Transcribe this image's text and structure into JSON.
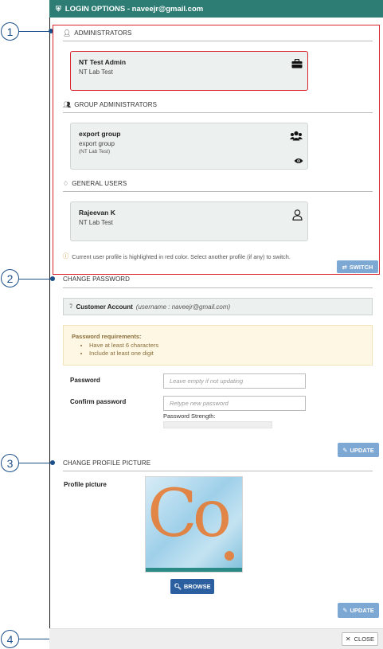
{
  "header": {
    "title": "LOGIN OPTIONS - naveejr@gmail.com"
  },
  "login_options": {
    "administrators": {
      "heading": "ADMINISTRATORS",
      "cards": [
        {
          "name": "NT Test Admin",
          "org": "NT Lab Test",
          "icon": "briefcase-icon",
          "active": true
        }
      ]
    },
    "group_administrators": {
      "heading": "GROUP ADMINISTRATORS",
      "cards": [
        {
          "name": "export group",
          "sub": "export group",
          "org": "(NT Lab Test)",
          "icon": "users-icon"
        }
      ]
    },
    "general_users": {
      "heading": "GENERAL USERS",
      "cards": [
        {
          "name": "Rajeevan K",
          "org": "NT Lab Test",
          "icon": "user-icon"
        }
      ]
    },
    "info": "Current user profile is highlighted in red color. Select another profile (if any) to switch.",
    "switch_label": "SWITCH"
  },
  "change_password": {
    "heading": "CHANGE PASSWORD",
    "account_label": "Customer Account",
    "account_detail": "(username : naveejr@gmail.com)",
    "requirements_title": "Password requirements:",
    "requirements": [
      "Have at least 6 characters",
      "Include at least one digit"
    ],
    "password_label": "Password",
    "password_placeholder": "Leave empty if not updating",
    "confirm_label": "Confirm password",
    "confirm_placeholder": "Retype new password",
    "strength_label": "Password Strength:",
    "update_label": "UPDATE"
  },
  "profile_picture": {
    "heading": "CHANGE PROFILE PICTURE",
    "label": "Profile picture",
    "browse_label": "BROWSE",
    "update_label": "UPDATE"
  },
  "footer": {
    "close_label": "CLOSE"
  },
  "callouts": [
    "1",
    "2",
    "3",
    "4"
  ],
  "colors": {
    "header": "#2e7d74",
    "highlight": "#d9232e",
    "callout": "#1b4f8a",
    "button": "#7ea8d4",
    "browse": "#2c5fa0"
  }
}
